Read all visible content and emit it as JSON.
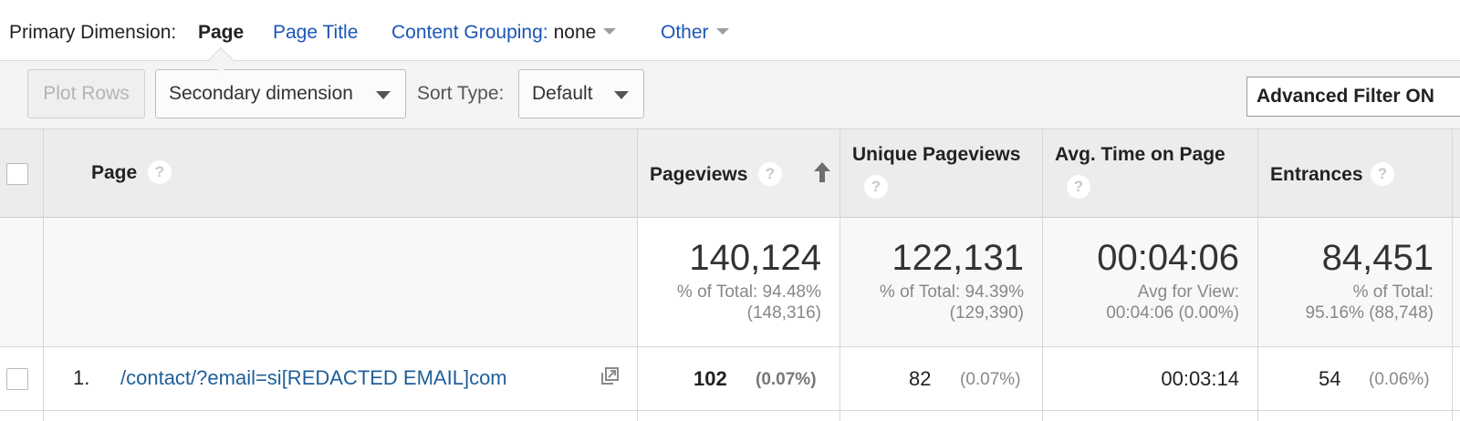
{
  "primary_dimension": {
    "label": "Primary Dimension:",
    "active": "Page",
    "page_title": "Page Title",
    "content_grouping_label": "Content Grouping:",
    "content_grouping_value": "none",
    "other": "Other"
  },
  "toolbar": {
    "plot_rows": "Plot Rows",
    "secondary_dimension": "Secondary dimension",
    "sort_type_label": "Sort Type:",
    "sort_type_value": "Default",
    "advanced_filter": "Advanced Filter ON"
  },
  "table": {
    "headers": {
      "page": "Page",
      "pageviews": "Pageviews",
      "unique_pageviews": "Unique Pageviews",
      "avg_time": "Avg. Time on Page",
      "entrances": "Entrances",
      "help": "?"
    },
    "totals": {
      "pageviews": "140,124",
      "pageviews_sub1": "% of Total: 94.48%",
      "pageviews_sub2": "(148,316)",
      "unique_pageviews": "122,131",
      "unique_pageviews_sub1": "% of Total: 94.39%",
      "unique_pageviews_sub2": "(129,390)",
      "avg_time": "00:04:06",
      "avg_time_sub1": "Avg for View:",
      "avg_time_sub2": "00:04:06 (0.00%)",
      "entrances": "84,451",
      "entrances_sub1": "% of Total:",
      "entrances_sub2": "95.16% (88,748)"
    },
    "rows": [
      {
        "index": "1.",
        "page": "/contact/?email=si[REDACTED EMAIL]com",
        "pageviews": "102",
        "pageviews_pct": "(0.07%)",
        "unique_pageviews": "82",
        "unique_pageviews_pct": "(0.07%)",
        "avg_time": "00:03:14",
        "entrances": "54",
        "entrances_pct": "(0.06%)"
      }
    ]
  },
  "colors": {
    "link": "#1a56b8",
    "row_link": "#1f5f99",
    "header_bg": "#ececec",
    "toolbar_bg": "#f4f4f4"
  },
  "icons": [
    "caret-down-icon",
    "help-icon",
    "sort-ascending-icon",
    "open-page-icon",
    "checkbox-icon"
  ]
}
